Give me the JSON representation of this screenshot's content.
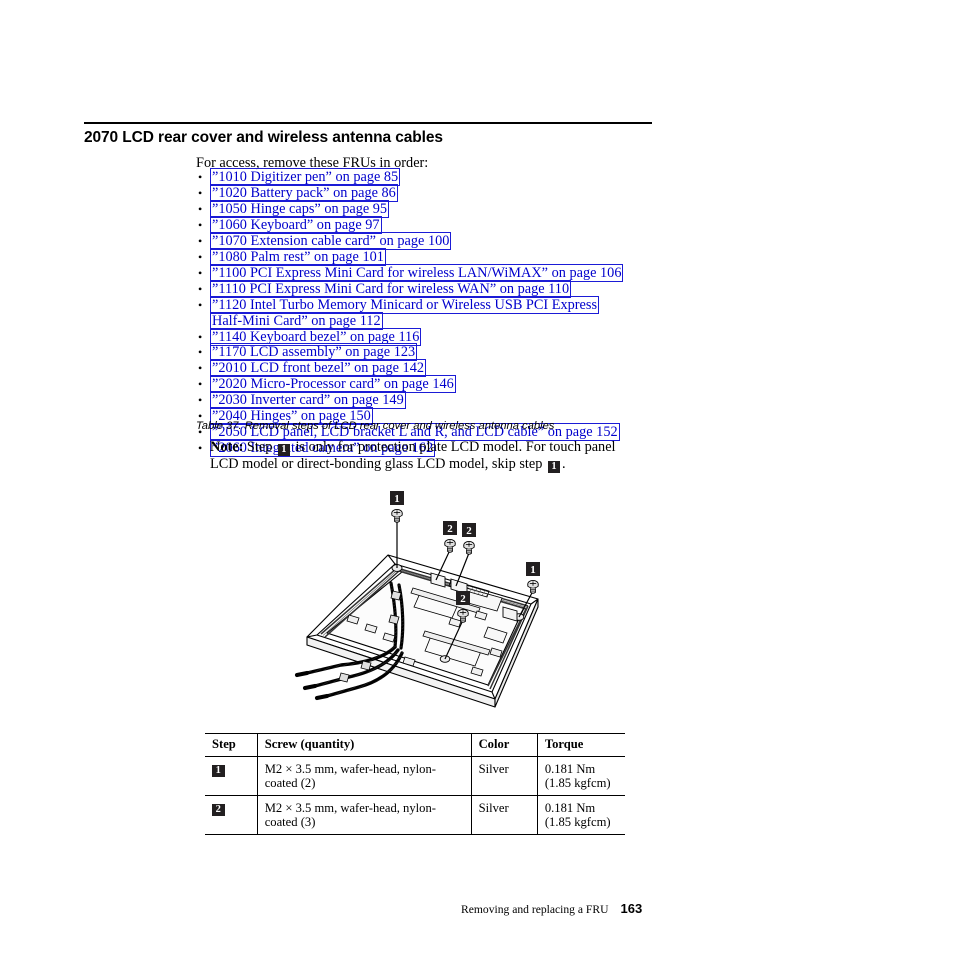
{
  "heading": "2070 LCD rear cover and wireless antenna cables",
  "intro": "For access, remove these FRUs in order:",
  "fru_list": [
    "”1010 Digitizer pen” on page 85",
    "”1020 Battery pack” on page 86",
    "”1050 Hinge caps” on page 95",
    "”1060 Keyboard” on page 97",
    "”1070 Extension cable card” on page 100",
    "”1080 Palm rest” on page 101",
    "”1100 PCI Express Mini Card for wireless LAN/WiMAX” on page 106",
    "”1110 PCI Express Mini Card for wireless WAN” on page 110",
    "”1120 Intel Turbo Memory Minicard or Wireless USB PCI Express Half-Mini Card” on page 112",
    "”1140 Keyboard bezel” on page 116",
    "”1170 LCD assembly” on page 123",
    "”2010 LCD front bezel” on page 142",
    "”2020 Micro-Processor card” on page 146",
    "”2030 Inverter card” on page 149",
    "”2040 Hinges” on page 150",
    "”2050 LCD panel, LCD bracket L and R, and LCD cable” on page 152",
    "”2060 Integrated camera” on page 162"
  ],
  "table_caption": "Table 37. Removal steps of LCD rear cover and wireless antenna cables",
  "note": {
    "label": "Note:",
    "part1": "Step",
    "badge1": "1",
    "part2": "is only for protection plate LCD model. For touch panel LCD model or direct-bonding glass LCD model, skip step",
    "badge2": "1",
    "part3": "."
  },
  "figure": {
    "alt": "Isometric line drawing of LCD rear cover with wireless antenna cables and screw callouts",
    "callouts": [
      {
        "label": "1",
        "note": "top-left screw callout"
      },
      {
        "label": "2",
        "note": "upper-middle-left screw callout"
      },
      {
        "label": "2",
        "note": "upper-middle-right screw callout"
      },
      {
        "label": "1",
        "note": "right screw callout"
      },
      {
        "label": "2",
        "note": "center screw callout"
      }
    ]
  },
  "screw_table": {
    "headers": [
      "Step",
      "Screw (quantity)",
      "Color",
      "Torque"
    ],
    "rows": [
      {
        "step": "1",
        "screw": "M2 × 3.5 mm, wafer-head, nylon-coated (2)",
        "color": "Silver",
        "torque_line1": "0.181 Nm",
        "torque_line2": "(1.85 kgfcm)"
      },
      {
        "step": "2",
        "screw": "M2 × 3.5 mm, wafer-head, nylon-coated (3)",
        "color": "Silver",
        "torque_line1": "0.181 Nm",
        "torque_line2": "(1.85 kgfcm)"
      }
    ]
  },
  "footer": {
    "text": "Removing and replacing a FRU",
    "page_number": "163"
  },
  "colors": {
    "link": "#0000cc",
    "link_box": "#1b1bd6",
    "badge_bg": "#221f20",
    "rule": "#000000"
  }
}
